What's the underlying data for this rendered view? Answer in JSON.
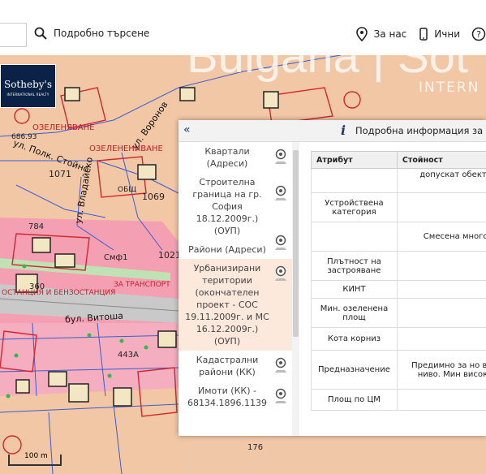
{
  "topbar": {
    "advanced_search": "Подробно търсене",
    "about": "За нас",
    "listings": "Ични",
    "help_partial": ""
  },
  "logo": {
    "name": "Sotheby's",
    "tagline": "INTERNATIONAL REALTY"
  },
  "watermark": {
    "main": "Bulgaria | Sot",
    "sub": "INTERN"
  },
  "map_labels": {
    "street_main": "бул. Витоша",
    "street_vladaya": "ул. Владайско",
    "street_pofk": "ул. Полк. Стойно",
    "street_vorona": "ул. Воронов",
    "zone_ozel": "ОЗЕЛЕНЯВАНЕ",
    "zone_ozel2": "ОЗЕЛЕНЕНИВАНЕ",
    "station": "ОСТАНЦИЯ И БЕНЗОСТАНЦИЯ",
    "transport": "ЗА ТРАНСПОРТ",
    "n1071": "1071",
    "n1069": "1069",
    "n1021": "1021",
    "n784": "784",
    "n686": "686.93",
    "n360": "360",
    "n443": "443А",
    "n176": "176",
    "n1": "1",
    "n3": "3",
    "smf": "Смф1",
    "obsh": "ОБЩ"
  },
  "scale_label": "100 m",
  "panel": {
    "title": "Подробна информация за",
    "layers": [
      {
        "label": "Квартали (Адреси)",
        "active": false
      },
      {
        "label": "Строителна граница на гр. София 18.12.2009г.) (ОУП)",
        "active": false
      },
      {
        "label": "Райони (Адреси)",
        "active": false
      },
      {
        "label": "Урбанизирани територии (окончателен проект - СОС 19.11.2009г. и МС 16.12.2009г.) (ОУП)",
        "active": true
      },
      {
        "label": "Кадастрални райони (КК)",
        "active": false
      },
      {
        "label": "Имоти (КК) - 68134.1896.1139",
        "active": false
      }
    ],
    "table": {
      "col_attr": "Атрибут",
      "col_value": "Стойност",
      "rows": [
        {
          "attr": "",
          "value": "допускат обекти з"
        },
        {
          "attr": "Устройствена категория",
          "value": ""
        },
        {
          "attr": "",
          "value": "Смесена многоф"
        },
        {
          "attr": "Плътност на застрояване",
          "value": ""
        },
        {
          "attr": "КИНТ",
          "value": ""
        },
        {
          "attr": "Мин. озеленена площ",
          "value": ""
        },
        {
          "attr": "Кота корниз",
          "value": ""
        },
        {
          "attr": "Предназначение",
          "value": "Предимно за но второ ниво. Мин висока д"
        },
        {
          "attr": "Площ по ЦМ",
          "value": ""
        }
      ]
    }
  }
}
